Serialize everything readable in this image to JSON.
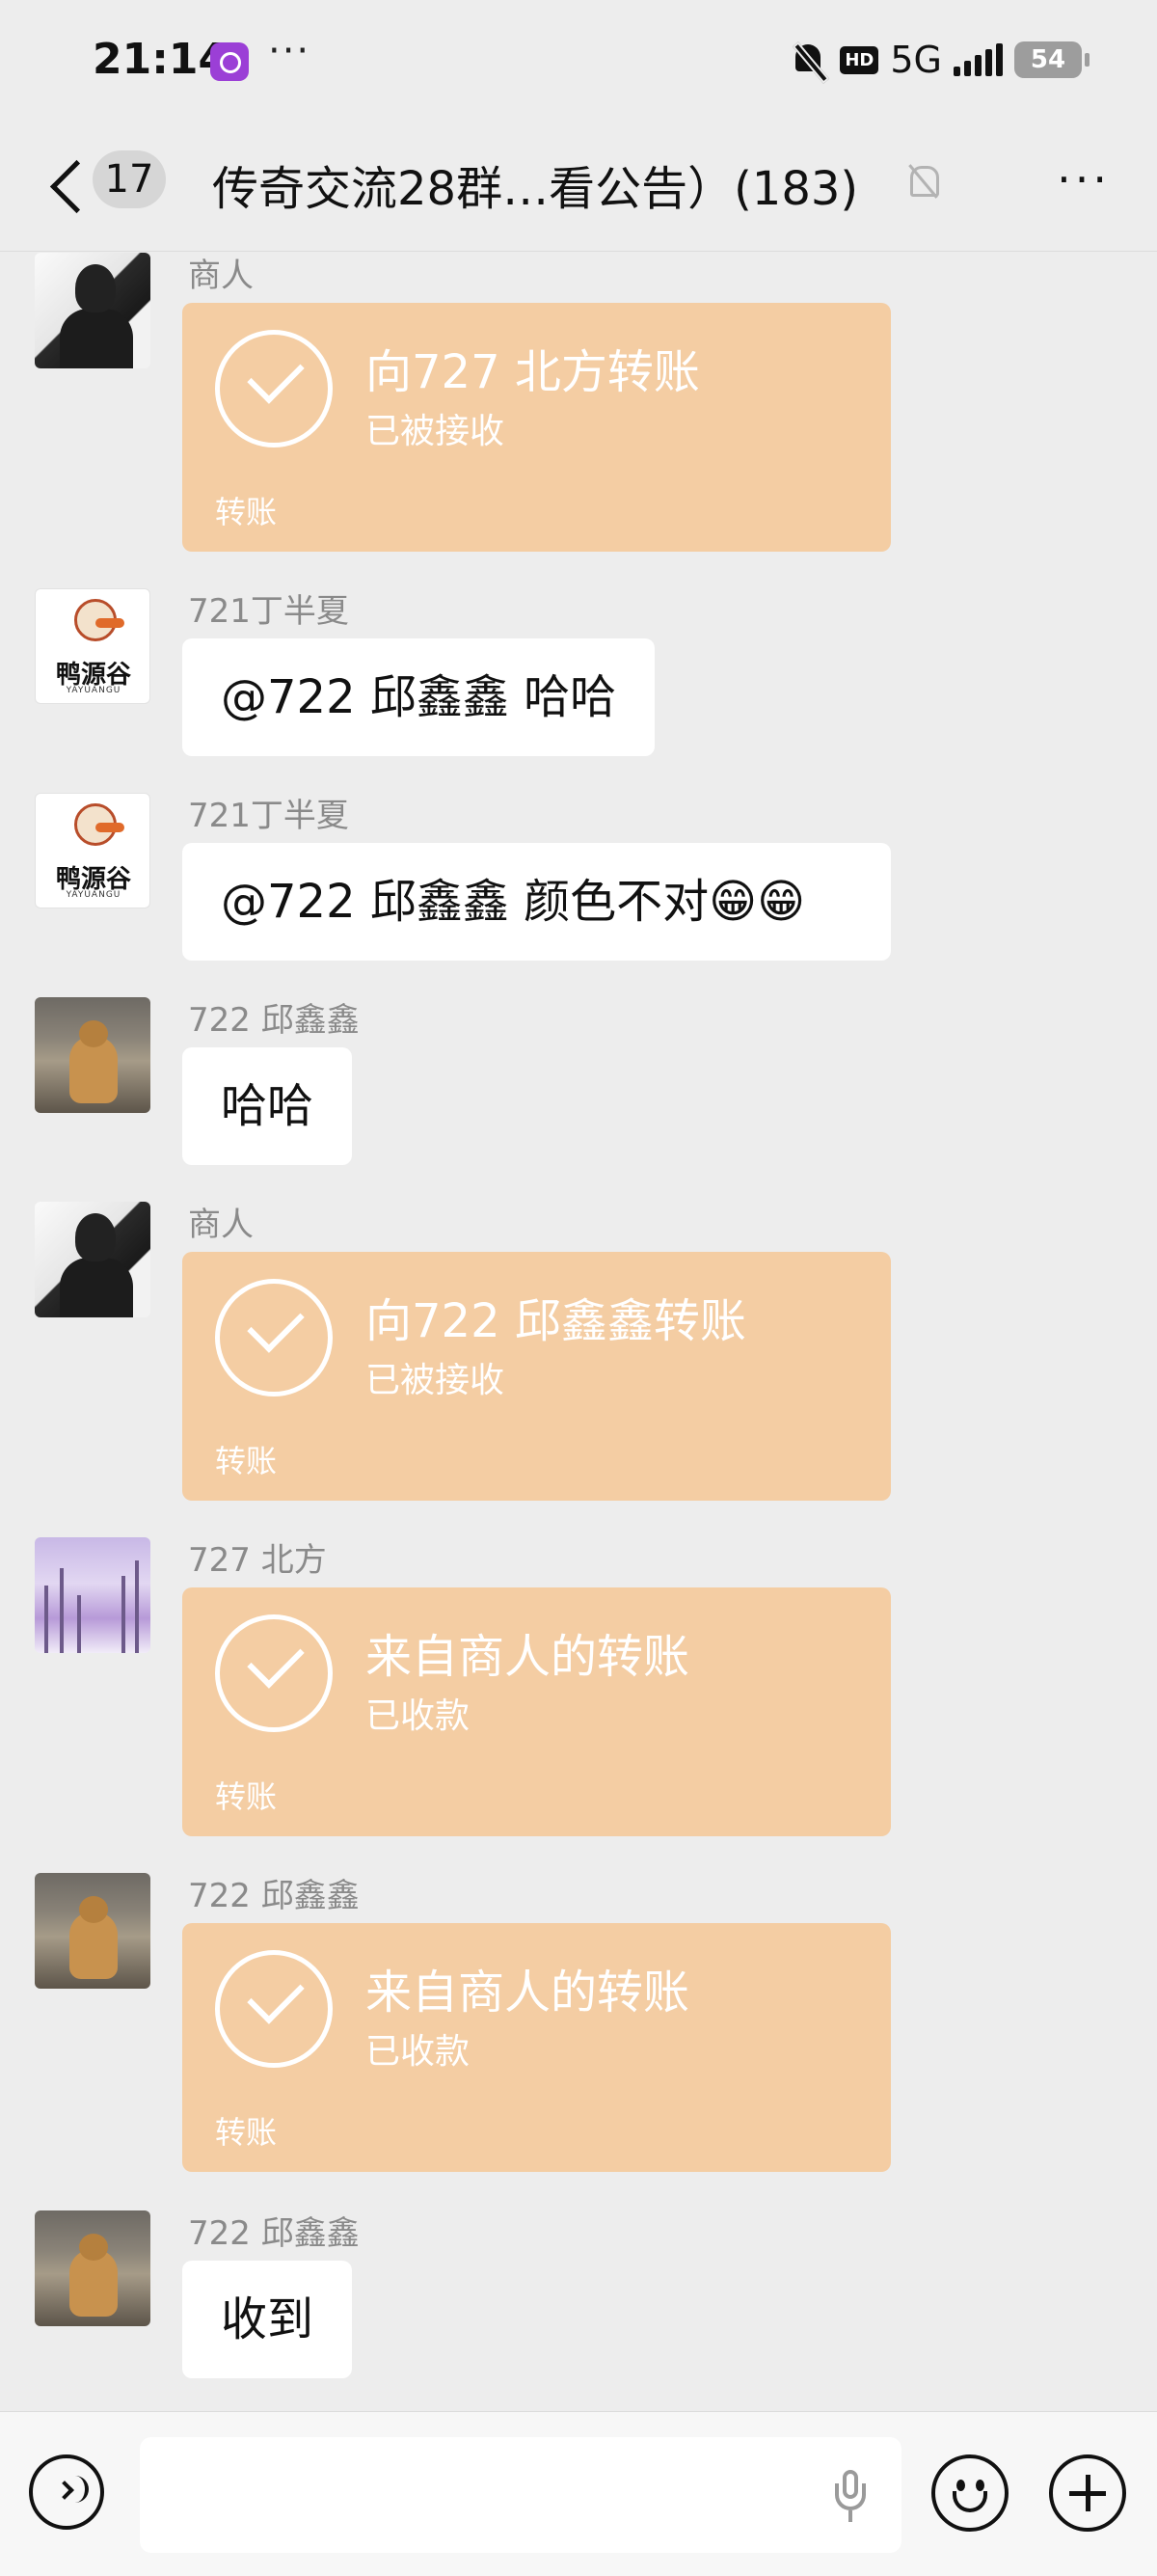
{
  "status_bar": {
    "time": "21:14",
    "dots": "···",
    "hd": "HD",
    "network": "5G",
    "battery": "54"
  },
  "header": {
    "unread_count": "17",
    "title": "传奇交流28群…看公告）(183)"
  },
  "messages": [
    {
      "sender": "商人",
      "kind": "transfer",
      "title": "向727  北方转账",
      "status": "已被接收",
      "type_label": "转账"
    },
    {
      "sender": "721丁半夏",
      "kind": "text",
      "text": "@722 邱鑫鑫  哈哈"
    },
    {
      "sender": "721丁半夏",
      "kind": "text",
      "text": "@722 邱鑫鑫  颜色不对😁😁"
    },
    {
      "sender": "722 邱鑫鑫",
      "kind": "text",
      "text": "哈哈"
    },
    {
      "sender": "商人",
      "kind": "transfer",
      "title": "向722 邱鑫鑫转账",
      "status": "已被接收",
      "type_label": "转账"
    },
    {
      "sender": "727  北方",
      "kind": "transfer",
      "title": "来自商人的转账",
      "status": "已收款",
      "type_label": "转账"
    },
    {
      "sender": "722 邱鑫鑫",
      "kind": "transfer",
      "title": "来自商人的转账",
      "status": "已收款",
      "type_label": "转账"
    },
    {
      "sender": "722 邱鑫鑫",
      "kind": "text",
      "text": "收到"
    }
  ],
  "avatars": {
    "duck_brand": "鸭源谷",
    "duck_sub": "YAYUANGU"
  },
  "input": {
    "value": "",
    "placeholder": ""
  },
  "colors": {
    "background": "#ededed",
    "transfer_bubble": "#f4cda3",
    "text_bubble": "#ffffff",
    "sender_name": "#8a8a8a"
  }
}
